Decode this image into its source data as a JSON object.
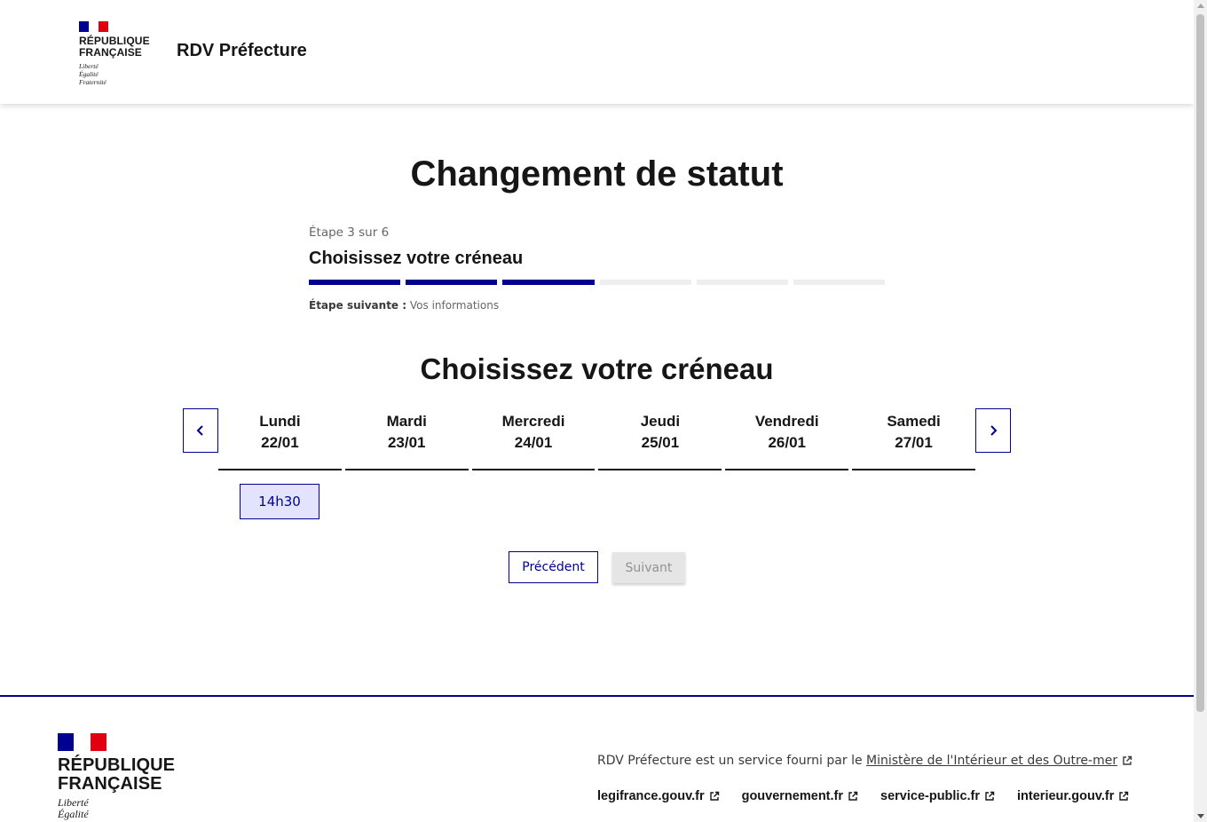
{
  "header": {
    "brand": {
      "name_line1": "RÉPUBLIQUE",
      "name_line2": "FRANÇAISE",
      "motto_1": "Liberté",
      "motto_2": "Égalité",
      "motto_3": "Fraternité"
    },
    "service_title": "RDV Préfecture"
  },
  "main": {
    "title": "Changement de statut",
    "stepper": {
      "state": "Étape 3 sur 6",
      "current_title": "Choisissez votre créneau",
      "current_step": 3,
      "total_steps": 6,
      "next_label": "Étape suivante :",
      "next_value": "Vos informations"
    },
    "section_title": "Choisissez votre créneau",
    "days": [
      {
        "name": "Lundi",
        "date": "22/01"
      },
      {
        "name": "Mardi",
        "date": "23/01"
      },
      {
        "name": "Mercredi",
        "date": "24/01"
      },
      {
        "name": "Jeudi",
        "date": "25/01"
      },
      {
        "name": "Vendredi",
        "date": "26/01"
      },
      {
        "name": "Samedi",
        "date": "27/01"
      }
    ],
    "slots": [
      {
        "day": "Lundi",
        "time": "14h30",
        "selected": true
      }
    ],
    "buttons": {
      "previous": "Précédent",
      "next": "Suivant"
    }
  },
  "footer": {
    "brand": {
      "name_line1": "RÉPUBLIQUE",
      "name_line2": "FRANÇAISE",
      "motto_1": "Liberté",
      "motto_2": "Égalité"
    },
    "description": "RDV Préfecture est un service fourni par le",
    "ministry_link": "Ministère de l'Intérieur et des Outre-mer",
    "links": [
      "legifrance.gouv.fr",
      "gouvernement.fr",
      "service-public.fr",
      "interieur.gouv.fr"
    ]
  },
  "colors": {
    "primary": "#000091",
    "selected_slot_bg": "#e3e3fd",
    "disabled_bg": "#e5e5e5",
    "flag_red": "#e1000f"
  }
}
